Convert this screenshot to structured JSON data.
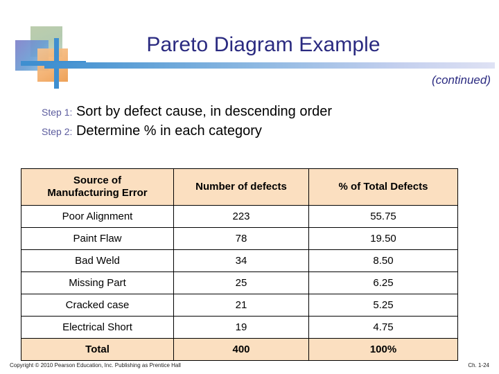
{
  "slide": {
    "title": "Pareto Diagram Example",
    "continued_note": "(continued)",
    "accent_color": "#2a2a80",
    "rule_color_start": "#3f8fd0",
    "rule_color_end": "#dfe2f4",
    "header_fill": "#fbdfc0"
  },
  "steps": [
    {
      "label": "Step 1:",
      "text": "Sort by defect cause, in descending order"
    },
    {
      "label": "Step 2:",
      "text": "Determine % in each category"
    }
  ],
  "table": {
    "headers": [
      "Source of\nManufacturing Error",
      "Number of defects",
      "% of Total Defects"
    ],
    "header_line1": "Source of",
    "header_line2": "Manufacturing Error",
    "rows": [
      {
        "source": "Poor Alignment",
        "defects": "223",
        "percent": "55.75"
      },
      {
        "source": "Paint Flaw",
        "defects": "78",
        "percent": "19.50"
      },
      {
        "source": "Bad Weld",
        "defects": "34",
        "percent": "8.50"
      },
      {
        "source": "Missing Part",
        "defects": "25",
        "percent": "6.25"
      },
      {
        "source": "Cracked case",
        "defects": "21",
        "percent": "5.25"
      },
      {
        "source": "Electrical Short",
        "defects": "19",
        "percent": "4.75"
      }
    ],
    "total": {
      "source": "Total",
      "defects": "400",
      "percent": "100%"
    }
  },
  "footer": {
    "copyright": "Copyright © 2010 Pearson Education, Inc. Publishing as Prentice Hall",
    "chapter": "Ch. 1-24"
  },
  "chart_data": {
    "type": "table",
    "title": "Pareto Diagram Example",
    "categories": [
      "Poor Alignment",
      "Paint Flaw",
      "Bad Weld",
      "Missing Part",
      "Cracked case",
      "Electrical Short"
    ],
    "series": [
      {
        "name": "Number of defects",
        "values": [
          223,
          78,
          34,
          25,
          21,
          19
        ]
      },
      {
        "name": "% of Total Defects",
        "values": [
          55.75,
          19.5,
          8.5,
          6.25,
          5.25,
          4.75
        ]
      }
    ],
    "totals": {
      "Number of defects": 400,
      "% of Total Defects": "100%"
    },
    "xlabel": "Source of Manufacturing Error",
    "ylabel": "Number of defects",
    "grid": false,
    "legend": "none"
  }
}
